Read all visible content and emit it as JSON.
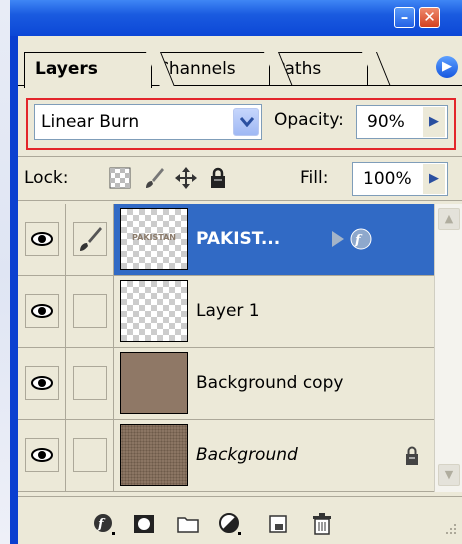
{
  "window": {
    "minimize_label": "–",
    "close_label": "✕",
    "menu_label": "▶"
  },
  "tabs": [
    {
      "label": "Layers",
      "active": true
    },
    {
      "label": "Channels",
      "active": false
    },
    {
      "label": "Paths",
      "active": false
    }
  ],
  "blend": {
    "mode": "Linear Burn",
    "opacity_label": "Opacity:",
    "opacity_value": "90%"
  },
  "lock": {
    "label": "Lock:",
    "fill_label": "Fill:",
    "fill_value": "100%"
  },
  "layers": [
    {
      "name": "PAKIST...",
      "selected": true,
      "visible": true,
      "thumb": "text",
      "thumb_text": "PAKISTAN",
      "italic": false
    },
    {
      "name": "Layer 1",
      "selected": false,
      "visible": true,
      "thumb": "transparent",
      "italic": false
    },
    {
      "name": "Background copy",
      "selected": false,
      "visible": true,
      "thumb": "brown",
      "italic": false
    },
    {
      "name": "Background",
      "selected": false,
      "visible": true,
      "thumb": "noisebrown",
      "italic": true,
      "locked": true
    }
  ],
  "colors": {
    "accent": "#316ac5",
    "highlight_border": "#e3262b",
    "titlebar": "#0c47d6"
  },
  "bottom_icons": [
    "layer-style-icon",
    "mask-icon",
    "folder-icon",
    "adjustment-layer-icon",
    "new-layer-icon",
    "trash-icon"
  ]
}
